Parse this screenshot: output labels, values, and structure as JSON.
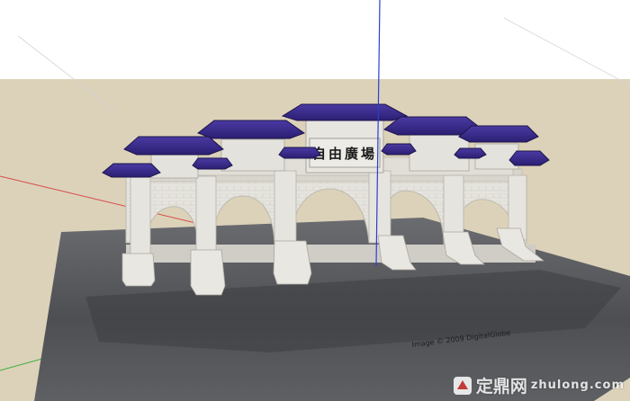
{
  "scene": {
    "plaque_text": "自由廣場",
    "ground_text": "Image © 2009 DigitalGlobe",
    "colors": {
      "sky": "#ffffff",
      "ground": "#dcd2b9",
      "slab": "#55575b",
      "stone": "#e4e2dc",
      "roof": "#3d2f8c",
      "roof_dark": "#24185e"
    }
  },
  "watermark": {
    "brand": "定鼎网",
    "domain": "zhulong.com"
  }
}
